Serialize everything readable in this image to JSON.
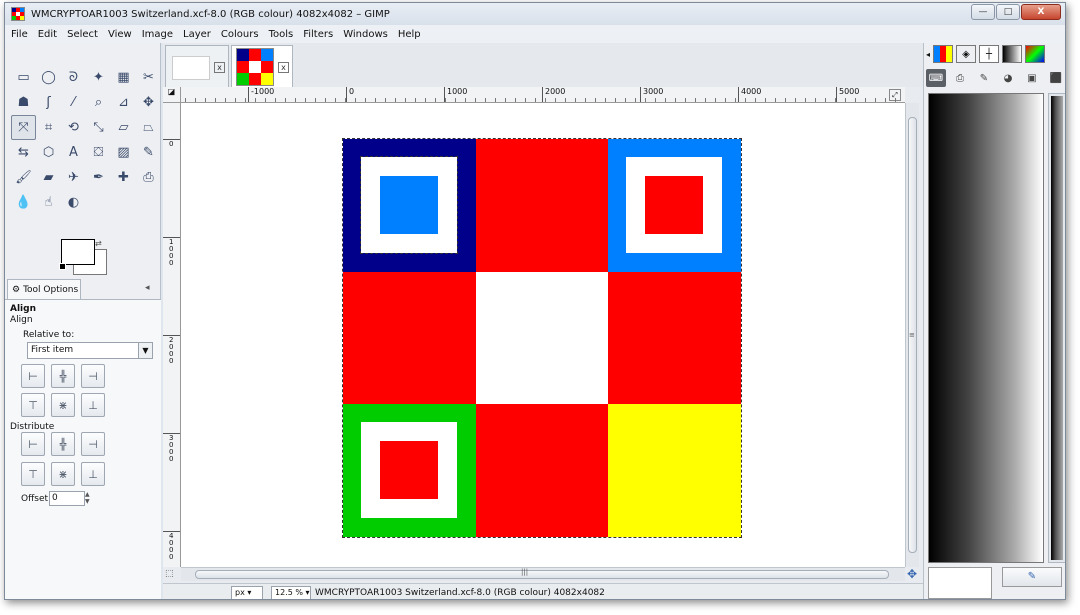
{
  "window": {
    "title": "WMCRYPTOAR1003 Switzerland.xcf-8.0 (RGB colour) 4082x4082 – GIMP",
    "controls": {
      "minimize": "—",
      "maximize": "□",
      "close": "X"
    }
  },
  "menu": [
    "File",
    "Edit",
    "Select",
    "View",
    "Image",
    "Layer",
    "Colours",
    "Tools",
    "Filters",
    "Windows",
    "Help"
  ],
  "toolbox": {
    "tools": [
      {
        "name": "rect-select-tool-icon",
        "glyph": "▭"
      },
      {
        "name": "ellipse-select-tool-icon",
        "glyph": "◯"
      },
      {
        "name": "free-select-tool-icon",
        "glyph": "ᘐ"
      },
      {
        "name": "fuzzy-select-tool-icon",
        "glyph": "✦"
      },
      {
        "name": "color-select-tool-icon",
        "glyph": "▦"
      },
      {
        "name": "scissors-select-tool-icon",
        "glyph": "✂"
      },
      {
        "name": "foreground-select-tool-icon",
        "glyph": "☗"
      },
      {
        "name": "paths-tool-icon",
        "glyph": "ʃ"
      },
      {
        "name": "color-picker-tool-icon",
        "glyph": "⁄"
      },
      {
        "name": "zoom-tool-icon",
        "glyph": "⌕"
      },
      {
        "name": "measure-tool-icon",
        "glyph": "⊿"
      },
      {
        "name": "move-tool-icon",
        "glyph": "✥"
      },
      {
        "name": "align-tool-icon",
        "glyph": "⤧"
      },
      {
        "name": "crop-tool-icon",
        "glyph": "⌗"
      },
      {
        "name": "rotate-tool-icon",
        "glyph": "⟲"
      },
      {
        "name": "scale-tool-icon",
        "glyph": "⤡"
      },
      {
        "name": "shear-tool-icon",
        "glyph": "▱"
      },
      {
        "name": "perspective-tool-icon",
        "glyph": "⏢"
      },
      {
        "name": "flip-tool-icon",
        "glyph": "⇆"
      },
      {
        "name": "cage-transform-tool-icon",
        "glyph": "⬡"
      },
      {
        "name": "text-tool-icon",
        "glyph": "A"
      },
      {
        "name": "bucket-fill-tool-icon",
        "glyph": "⛋"
      },
      {
        "name": "blend-tool-icon",
        "glyph": "▨"
      },
      {
        "name": "pencil-tool-icon",
        "glyph": "✎"
      },
      {
        "name": "paintbrush-tool-icon",
        "glyph": "🖌"
      },
      {
        "name": "eraser-tool-icon",
        "glyph": "▰"
      },
      {
        "name": "airbrush-tool-icon",
        "glyph": "✈"
      },
      {
        "name": "ink-tool-icon",
        "glyph": "✒"
      },
      {
        "name": "heal-tool-icon",
        "glyph": "✚"
      },
      {
        "name": "clone-tool-icon",
        "glyph": "⎙"
      },
      {
        "name": "blur-tool-icon",
        "glyph": "💧"
      },
      {
        "name": "smudge-tool-icon",
        "glyph": "☝"
      },
      {
        "name": "dodge-burn-tool-icon",
        "glyph": "◐"
      }
    ],
    "active_tool_index": 12
  },
  "tool_options": {
    "tab_label": "Tool Options",
    "heading": "Align",
    "subheading": "Align",
    "relative_to_label": "Relative to:",
    "relative_to_value": "First item",
    "distribute_label": "Distribute",
    "offset_label": "Offset:",
    "offset_value": "0"
  },
  "image_tabs": {
    "close_glyph": "x"
  },
  "rulers": {
    "top_labels": [
      "-1000",
      "0",
      "1000",
      "2000",
      "3000",
      "4000",
      "5000"
    ],
    "left_labels": [
      "0",
      "1000",
      "2000",
      "3000",
      "4000"
    ]
  },
  "image": {
    "colors": {
      "navy": "#00008b",
      "red": "#ff0000",
      "blue": "#0080ff",
      "white": "#ffffff",
      "green": "#00cc00",
      "yellow": "#ffff00"
    }
  },
  "statusbar": {
    "unit": "px",
    "zoom": "12.5 %",
    "text": "WMCRYPTOAR1003 Switzerland.xcf-8.0 (RGB colour) 4082x4082"
  }
}
